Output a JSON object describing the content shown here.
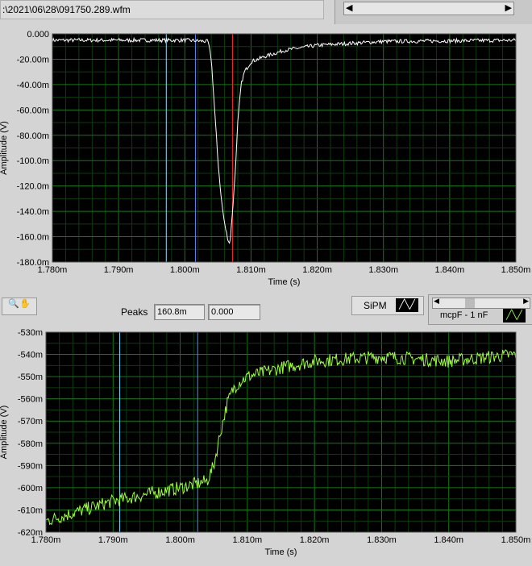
{
  "file_path": ":\\2021\\06\\28\\091750.289.wfm",
  "toolbar": {
    "peaks_label": "Peaks",
    "peak_value": "160.8m",
    "peak_value2": "0.000",
    "plot1_legend": "SiPM",
    "plot2_legend": "mcpF - 1 nF"
  },
  "chart_data": [
    {
      "type": "line",
      "title": "",
      "xlabel": "Time (s)",
      "ylabel": "Amplitude (V)",
      "xlim": [
        1.78,
        1.85
      ],
      "ylim": [
        -180,
        0
      ],
      "xticks": [
        "1.780m",
        "1.790m",
        "1.800m",
        "1.810m",
        "1.820m",
        "1.830m",
        "1.840m",
        "1.850m"
      ],
      "yticks": [
        "0.000",
        "-20.00m",
        "-40.00m",
        "-60.00m",
        "-80.00m",
        "-100.0m",
        "-120.0m",
        "-140.0m",
        "-160.0m",
        "-180.0m"
      ],
      "series": [
        {
          "name": "SiPM",
          "color": "#ffffff",
          "x": [
            1.78,
            1.8,
            1.8035,
            1.804,
            1.8045,
            1.805,
            1.8055,
            1.806,
            1.8065,
            1.8068,
            1.8072,
            1.8076,
            1.808,
            1.8085,
            1.809,
            1.81,
            1.812,
            1.815,
            1.82,
            1.83,
            1.85
          ],
          "y": [
            -5,
            -5,
            -6,
            -20,
            -60,
            -100,
            -130,
            -150,
            -162,
            -166,
            -140,
            -110,
            -70,
            -40,
            -30,
            -22,
            -18,
            -13,
            -9,
            -6,
            -5
          ]
        }
      ],
      "cursors": [
        {
          "x": 1.7972,
          "color": "#8fe0ff"
        },
        {
          "x": 1.8016,
          "color": "#5a8cff"
        },
        {
          "x": 1.8072,
          "color": "#ff2a2a"
        }
      ]
    },
    {
      "type": "line",
      "title": "",
      "xlabel": "Time (s)",
      "ylabel": "Amplitude (V)",
      "xlim": [
        1.78,
        1.85
      ],
      "ylim": [
        -620,
        -530
      ],
      "xticks": [
        "1.780m",
        "1.790m",
        "1.800m",
        "1.810m",
        "1.820m",
        "1.830m",
        "1.840m",
        "1.850m"
      ],
      "yticks": [
        "-530m",
        "-540m",
        "-550m",
        "-560m",
        "-570m",
        "-580m",
        "-590m",
        "-600m",
        "-610m",
        "-620m"
      ],
      "series": [
        {
          "name": "mcpF - 1 nF",
          "color": "#9cff3a",
          "x": [
            1.78,
            1.79,
            1.8,
            1.804,
            1.805,
            1.806,
            1.807,
            1.808,
            1.809,
            1.81,
            1.815,
            1.82,
            1.83,
            1.84,
            1.85
          ],
          "y": [
            -615,
            -606,
            -600,
            -597,
            -590,
            -575,
            -562,
            -555,
            -552,
            -550,
            -546,
            -543,
            -541,
            -543,
            -540
          ]
        }
      ],
      "cursors": [
        {
          "x": 1.791,
          "color": "#8fe0ff"
        },
        {
          "x": 1.8026,
          "color": "#5a8cff"
        }
      ]
    }
  ]
}
